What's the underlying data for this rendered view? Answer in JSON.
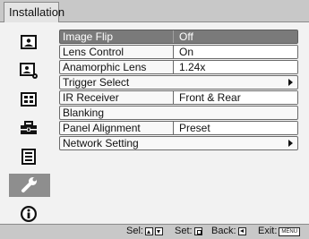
{
  "header": {
    "title": "Installation"
  },
  "sidebar": {
    "items": [
      {
        "icon": "picture-icon",
        "selected": false
      },
      {
        "icon": "picture-adjust-icon",
        "selected": false
      },
      {
        "icon": "screen-icon",
        "selected": false
      },
      {
        "icon": "setup-toolbox-icon",
        "selected": false
      },
      {
        "icon": "function-list-icon",
        "selected": false
      },
      {
        "icon": "wrench-icon",
        "selected": true
      },
      {
        "icon": "information-icon",
        "selected": false
      }
    ]
  },
  "menu": {
    "items": [
      {
        "label": "Image Flip",
        "value": "Off"
      },
      {
        "label": "Lens Control",
        "value": "On"
      },
      {
        "label": "Anamorphic Lens",
        "value": "1.24x"
      },
      {
        "label": "Trigger Select",
        "value": ""
      },
      {
        "label": "IR Receiver",
        "value": "Front & Rear"
      },
      {
        "label": "Blanking",
        "value": ""
      },
      {
        "label": "Panel Alignment",
        "value": "Preset"
      },
      {
        "label": "Network Setting",
        "value": ""
      }
    ],
    "selected_index": 0
  },
  "status": {
    "sel_label": "Sel:",
    "set_label": "Set:",
    "back_label": "Back:",
    "exit_label": "Exit:",
    "menu_key": "MENU"
  },
  "colors": {
    "selected_row": "#7a7a7a",
    "title_bar": "#c8c8c8",
    "selected_icon": "#8e8e8e"
  }
}
